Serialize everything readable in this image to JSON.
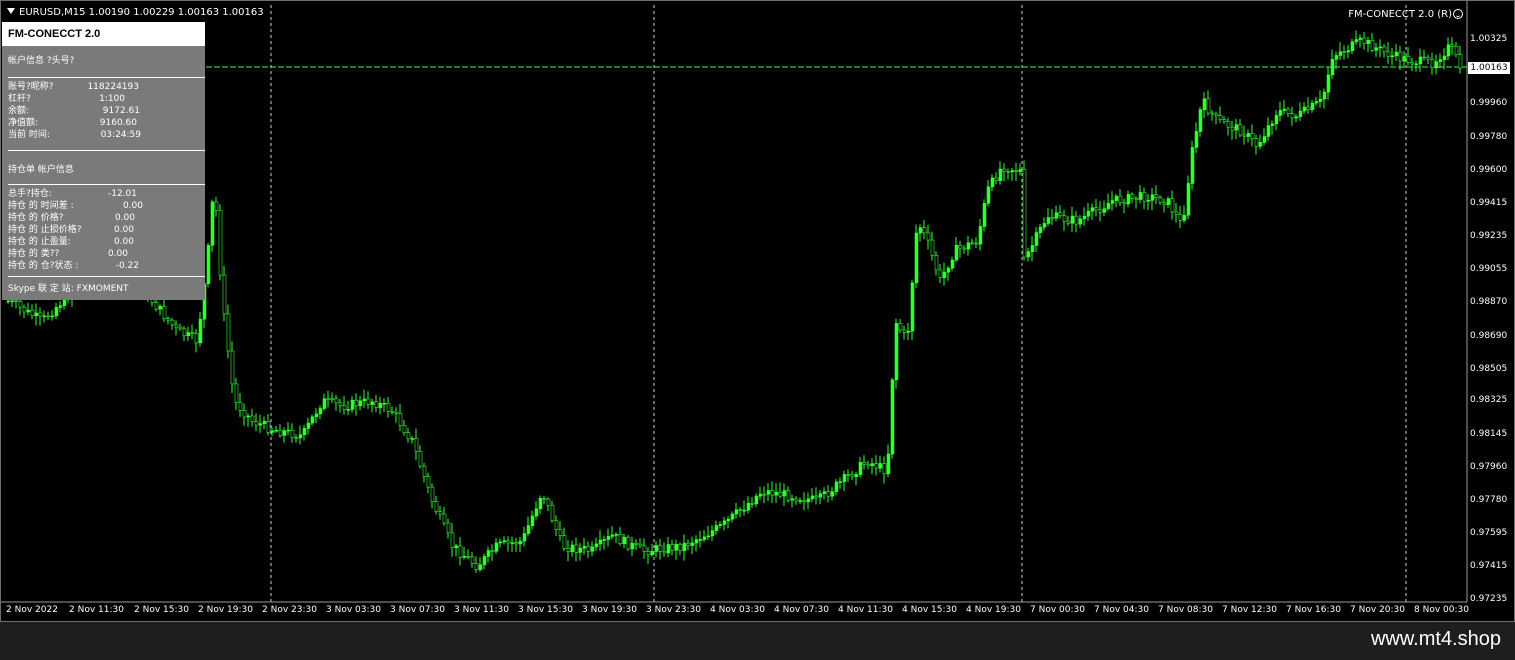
{
  "chart": {
    "symbol_info": "EURUSD,M15  1.00190 1.00229 1.00163 1.00163",
    "ea_name": "FM-CONECCT 2.0 (R)",
    "current_price": "1.00163",
    "price_axis": [
      "1.00325",
      "1.00163",
      "0.99960",
      "0.99780",
      "0.99600",
      "0.99415",
      "0.99235",
      "0.99055",
      "0.98870",
      "0.98690",
      "0.98505",
      "0.98325",
      "0.98145",
      "0.97960",
      "0.97780",
      "0.97595",
      "0.97415",
      "0.97235"
    ],
    "time_axis": [
      "2 Nov 2022",
      "2 Nov 11:30",
      "2 Nov 15:30",
      "2 Nov 19:30",
      "2 Nov 23:30",
      "3 Nov 03:30",
      "3 Nov 07:30",
      "3 Nov 11:30",
      "3 Nov 15:30",
      "3 Nov 19:30",
      "3 Nov 23:30",
      "4 Nov 03:30",
      "4 Nov 07:30",
      "4 Nov 11:30",
      "4 Nov 15:30",
      "4 Nov 19:30",
      "7 Nov 00:30",
      "7 Nov 04:30",
      "7 Nov 08:30",
      "7 Nov 12:30",
      "7 Nov 16:30",
      "7 Nov 20:30",
      "8 Nov 00:30"
    ],
    "colors": {
      "candle": "#33ff33",
      "grid": "#ffffff",
      "background": "#000000"
    }
  },
  "panel": {
    "title": "FM-CONECCT 2.0",
    "subtitle": "帐户信息 ?头号?",
    "account_rows": [
      {
        "label": "账号?昵称?",
        "value": "118224193"
      },
      {
        "label": "杠杆?",
        "value": "1:100"
      },
      {
        "label": "余额:",
        "value": "9172.61"
      },
      {
        "label": "净值额:",
        "value": "9160.60"
      },
      {
        "label": "当前  时间:",
        "value": "03:24:59"
      }
    ],
    "section2_title": "持仓单 帐户信息",
    "position_rows": [
      {
        "label": "总手?持仓:",
        "value": "-12.01"
      },
      {
        "label": "持仓 的 时间差  :",
        "value": "0.00"
      },
      {
        "label": "持仓 的 价格?",
        "value": "0.00"
      },
      {
        "label": "持仓 的 止损价格?",
        "value": "0.00"
      },
      {
        "label": "持仓 的 止盈量:",
        "value": "0.00"
      },
      {
        "label": "持仓 的 类??",
        "value": "0.00"
      },
      {
        "label": "持仓 的 仓?状态  :",
        "value": "-0.22"
      }
    ],
    "footer": "Skype 联   定   站: FXMOMENT"
  },
  "footer": {
    "brand": "www.mt4.shop"
  }
}
